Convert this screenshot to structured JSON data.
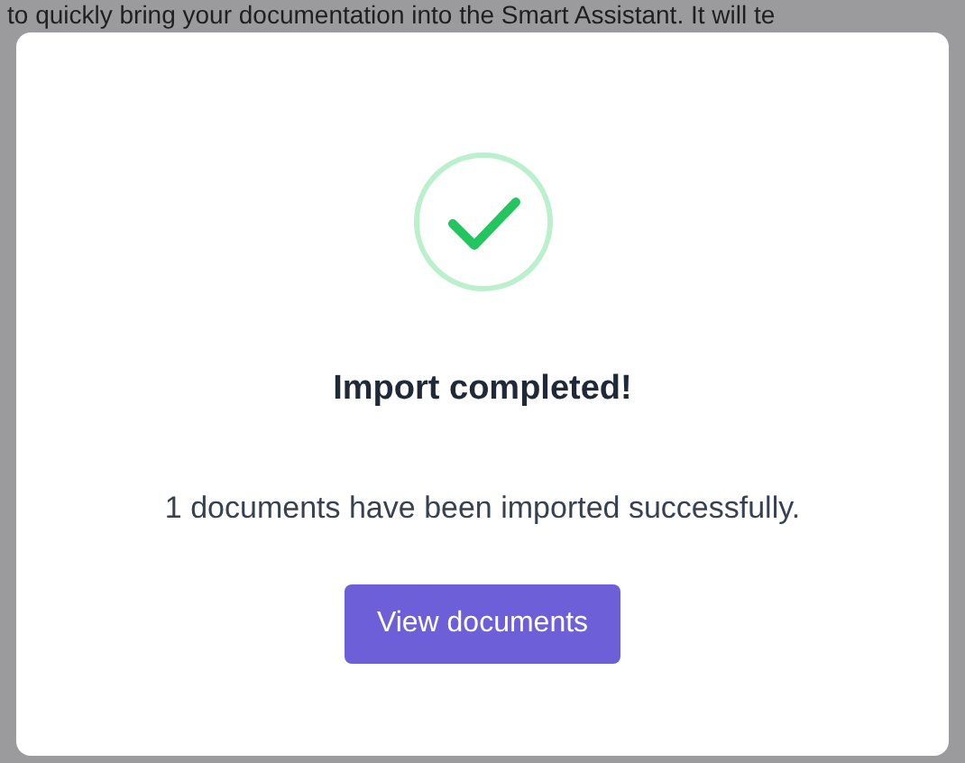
{
  "background": {
    "text": "to quickly bring your documentation into the Smart Assistant. It will te"
  },
  "dialog": {
    "title": "Import completed!",
    "message": "1 documents have been imported successfully.",
    "button": "View documents"
  }
}
